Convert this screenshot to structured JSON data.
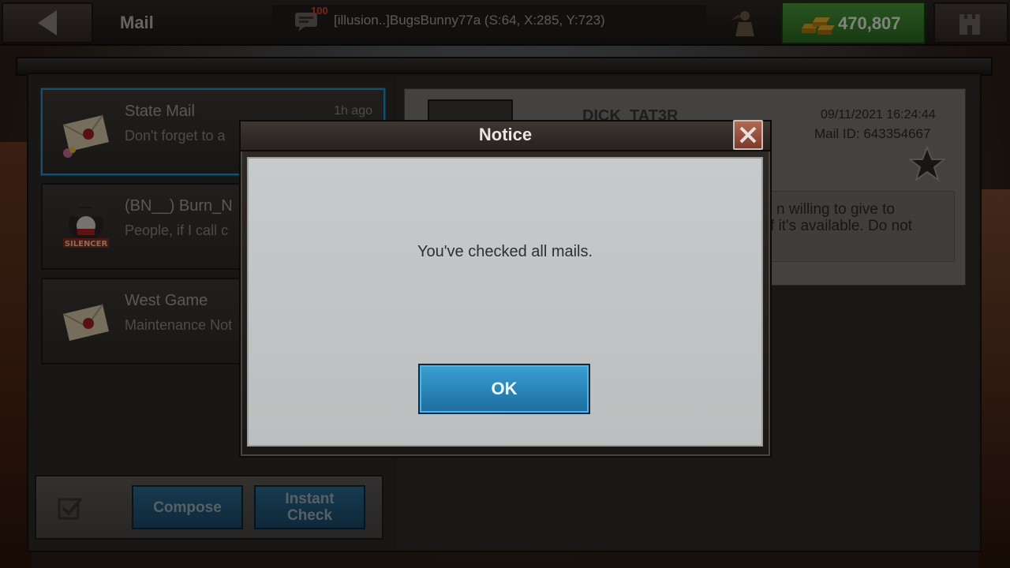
{
  "topbar": {
    "title": "Mail",
    "chat_count": "100",
    "chat_text": "[illusion..]BugsBunny77a (S:64, X:285, Y:723)",
    "gold_amount": "470,807"
  },
  "mail_list": [
    {
      "title": "State Mail",
      "preview": "Don't forget to a",
      "time": "1h ago",
      "icon": "envelope-icon"
    },
    {
      "title": "(BN__) Burn_N",
      "preview": "People, if I call c",
      "time": "",
      "icon": "silencer-badge-icon"
    },
    {
      "title": "West Game",
      "preview": "Maintenance Not",
      "time": "",
      "icon": "envelope-icon"
    }
  ],
  "bottom_bar": {
    "compose_label": "Compose",
    "instant_check_line1": "Instant",
    "instant_check_line2": "Check"
  },
  "detail": {
    "sender": "DICK_TAT3R",
    "date": "09/11/2021 16:24:44",
    "mail_id": "Mail ID: 643354667",
    "body_line1": "n willing to give to",
    "body_line2": "f it's available. Do not"
  },
  "modal": {
    "title": "Notice",
    "message": "You've checked all mails.",
    "ok_label": "OK"
  },
  "colors": {
    "accent_blue": "#2b8ec4",
    "gold_green": "#3a8a30",
    "close_red": "#9a4a38"
  }
}
